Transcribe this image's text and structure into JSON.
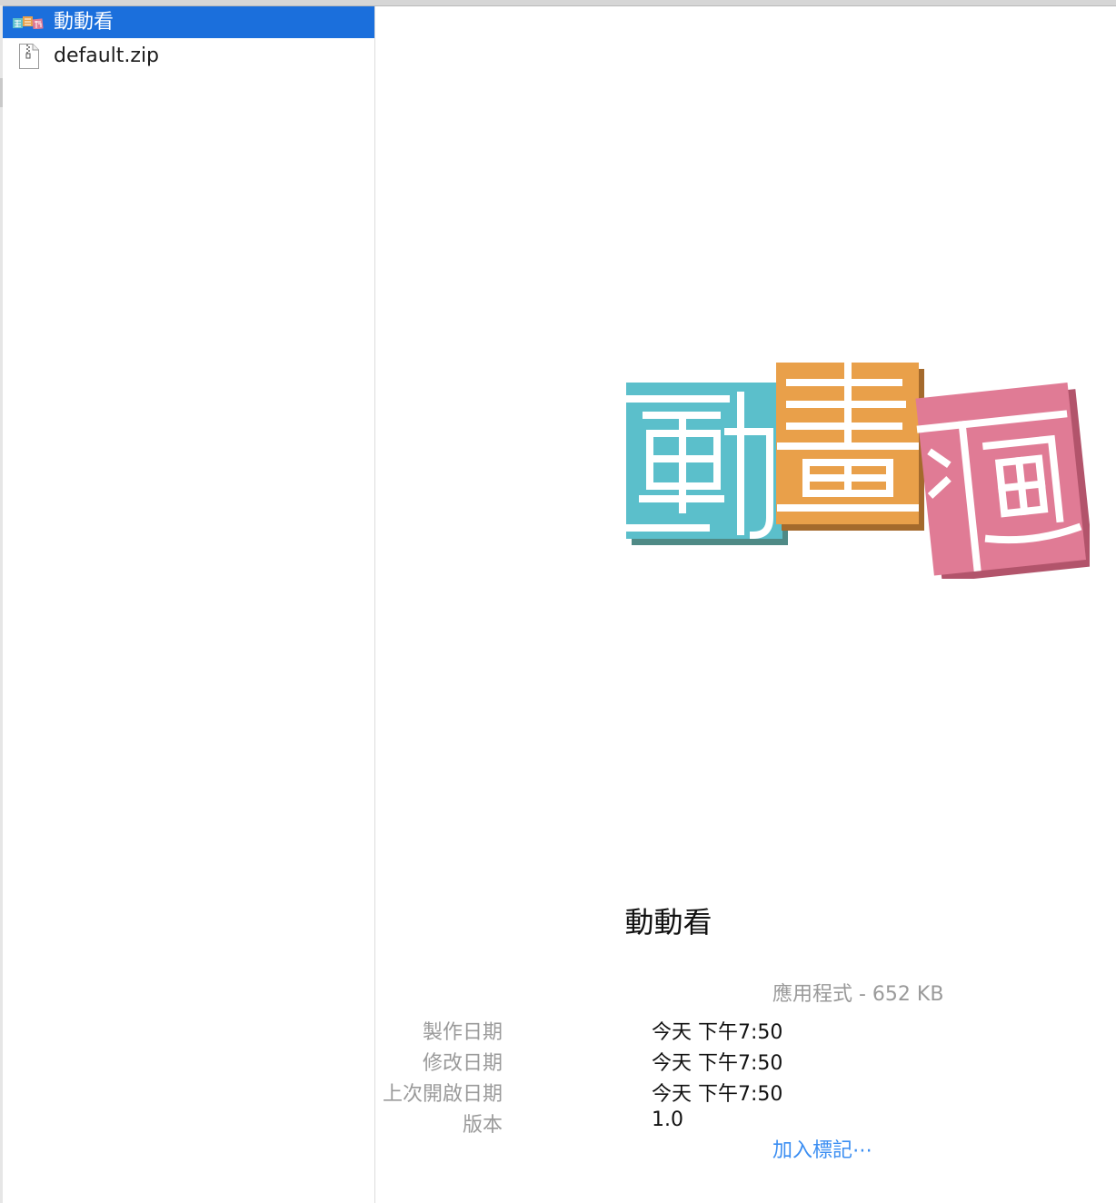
{
  "file_list": {
    "items": [
      {
        "name": "動動看",
        "icon": "app-icon",
        "selected": true
      },
      {
        "name": "default.zip",
        "icon": "zip-file-icon",
        "selected": false
      }
    ]
  },
  "preview": {
    "title": "動動看",
    "kind": "應用程式 - 652 KB",
    "rows": [
      {
        "label": "製作日期",
        "value": "今天 下午7:50"
      },
      {
        "label": "修改日期",
        "value": "今天 下午7:50"
      },
      {
        "label": "上次開啟日期",
        "value": "今天 下午7:50"
      },
      {
        "label": "版本",
        "value": "1.0"
      }
    ],
    "add_tags": "加入標記⋯"
  },
  "colors": {
    "selection": "#1b6fdc",
    "tile_teal": "#5bbfcb",
    "tile_orange": "#e9a04a",
    "tile_pink": "#e07b95",
    "link_blue": "#3b8ef2"
  }
}
